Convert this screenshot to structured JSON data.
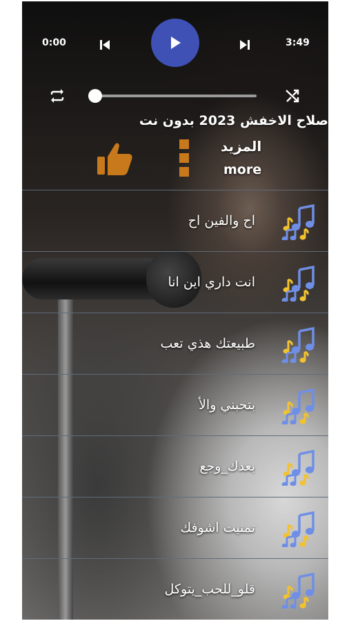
{
  "player": {
    "elapsed": "0:00",
    "duration": "3:49",
    "progress": 0.0
  },
  "album": {
    "title": "صلاح الاخفش 2023 بدون نت",
    "more_ar": "المزيد",
    "more_en": "more"
  },
  "tracks": [
    {
      "title": "اح والفين اح"
    },
    {
      "title": "انت داري اين انا"
    },
    {
      "title": "طبيعتك هذي تعب"
    },
    {
      "title": "بتحبني والأ"
    },
    {
      "title": "بعدك_وجع"
    },
    {
      "title": "تمنيت اشوفك"
    },
    {
      "title": "قلو_للحب_يتوكل"
    }
  ],
  "colors": {
    "accent": "#3f51b5",
    "thumb_icon": "#c8791c",
    "note_blue": "#6f8fe6",
    "note_yellow": "#f2c230"
  },
  "icons": {
    "prev": "skip-previous-icon",
    "play": "play-icon",
    "next": "skip-next-icon",
    "repeat": "repeat-icon",
    "shuffle": "shuffle-icon",
    "like": "thumbs-up-icon",
    "menu": "more-vertical-icon",
    "track": "music-notes-icon"
  }
}
